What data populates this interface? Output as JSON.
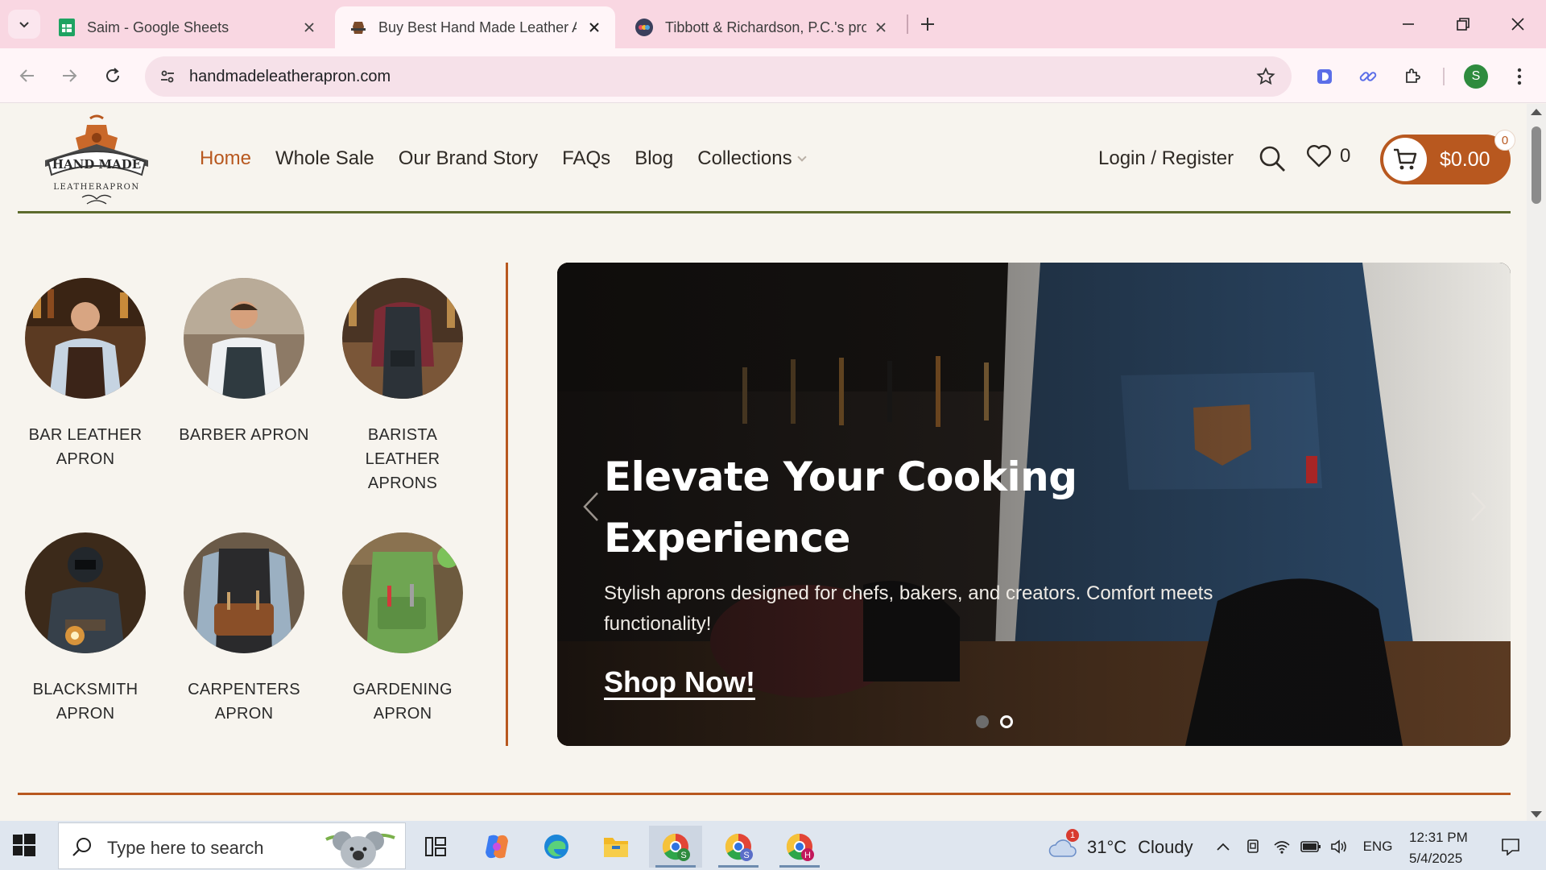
{
  "browser": {
    "tabs": [
      {
        "title": "Saim - Google Sheets",
        "icon": "google-sheets-icon",
        "active": false
      },
      {
        "title": "Buy Best Hand Made Leather Ap",
        "icon": "site-favicon",
        "active": true
      },
      {
        "title": "Tibbott & Richardson, P.C.'s pro",
        "icon": "site-favicon",
        "active": false
      }
    ],
    "url": "handmadeleatherapron.com",
    "profile_initial": "S"
  },
  "site": {
    "logo_text_top": "HAND MADE",
    "logo_text_bottom": "LEATHERAPRON",
    "nav": [
      {
        "label": "Home",
        "current": true
      },
      {
        "label": "Whole Sale",
        "current": false
      },
      {
        "label": "Our Brand Story",
        "current": false
      },
      {
        "label": "FAQs",
        "current": false
      },
      {
        "label": "Blog",
        "current": false
      },
      {
        "label": "Collections",
        "current": false,
        "has_dropdown": true
      }
    ],
    "login_label": "Login / Register",
    "wishlist_count": "0",
    "cart_total": "$0.00",
    "cart_count": "0",
    "colors": {
      "accent": "#b8581f",
      "header_line": "#5d6b2d",
      "background": "#f7f4ee"
    }
  },
  "categories": [
    {
      "label": "BAR LEATHER APRON"
    },
    {
      "label": "BARBER APRON"
    },
    {
      "label": "BARISTA LEATHER APRONS"
    },
    {
      "label": "BLACKSMITH APRON"
    },
    {
      "label": "CARPENTERS APRON"
    },
    {
      "label": "GARDENING APRON"
    }
  ],
  "hero": {
    "title": "Elevate Your Cooking Experience",
    "subtitle": "Stylish aprons designed for chefs, bakers, and creators. Comfort meets functionality!",
    "cta": "Shop Now!",
    "slide_count": 2,
    "current_slide": 2
  },
  "taskbar": {
    "search_placeholder": "Type here to search",
    "weather_temp": "31°C",
    "weather_cond": "Cloudy",
    "weather_badge": "1",
    "lang": "ENG",
    "time": "12:31 PM",
    "date": "5/4/2025"
  }
}
